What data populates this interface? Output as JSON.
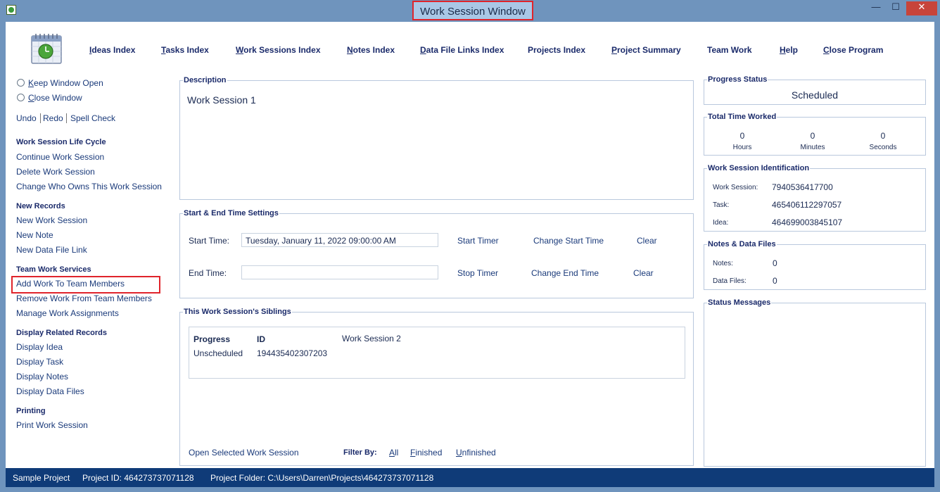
{
  "window": {
    "title": "Work Session Window",
    "min_glyph": "—",
    "max_glyph": "☐",
    "close_glyph": "✕"
  },
  "nav": {
    "items": [
      "Ideas Index",
      "Tasks Index",
      "Work Sessions Index",
      "Notes Index",
      "Data File Links Index",
      "Projects Index",
      "Project Summary",
      "Team Work",
      "Help",
      "Close Program"
    ]
  },
  "left": {
    "keep_open": "Keep Window Open",
    "close_window": "Close Window",
    "undo": "Undo",
    "redo": "Redo",
    "spell_check": "Spell Check",
    "lifecycle_head": "Work Session Life Cycle",
    "continue": "Continue Work Session",
    "delete": "Delete Work Session",
    "change_owner": "Change Who Owns This Work Session",
    "new_records_head": "New Records",
    "new_ws": "New Work Session",
    "new_note": "New Note",
    "new_dfl": "New Data File Link",
    "team_head": "Team Work Services",
    "add_work": "Add Work To Team Members",
    "remove_work": "Remove Work From Team Members",
    "manage": "Manage Work Assignments",
    "related_head": "Display Related Records",
    "disp_idea": "Display Idea",
    "disp_task": "Display Task",
    "disp_notes": "Display Notes",
    "disp_files": "Display Data Files",
    "printing_head": "Printing",
    "print_ws": "Print Work Session"
  },
  "description": {
    "label": "Description",
    "value": "Work Session 1"
  },
  "times": {
    "label": "Start & End Time Settings",
    "start_label": "Start Time:",
    "start_value": "Tuesday, January 11, 2022   09:00:00 AM",
    "start_timer": "Start Timer",
    "change_start": "Change Start Time",
    "clear1": "Clear",
    "end_label": "End Time:",
    "end_value": "",
    "stop_timer": "Stop Timer",
    "change_end": "Change End Time",
    "clear2": "Clear"
  },
  "siblings": {
    "label": "This Work Session's Siblings",
    "col_progress": "Progress",
    "col_id": "ID",
    "col_name": "Work Session 2",
    "row_progress": "Unscheduled",
    "row_id": "194435402307203",
    "open_selected": "Open Selected Work Session",
    "filter_by": "Filter By:",
    "all": "All",
    "finished": "Finished",
    "unfinished": "Unfinished"
  },
  "progress": {
    "label": "Progress Status",
    "value": "Scheduled"
  },
  "total_time": {
    "label": "Total Time Worked",
    "hours": "0",
    "minutes": "0",
    "seconds": "0",
    "hours_label": "Hours",
    "minutes_label": "Minutes",
    "seconds_label": "Seconds"
  },
  "identification": {
    "label": "Work Session Identification",
    "ws_label": "Work Session:",
    "ws_value": "7940536417700",
    "task_label": "Task:",
    "task_value": "465406112297057",
    "idea_label": "Idea:",
    "idea_value": "464699003845107"
  },
  "notes_files": {
    "label": "Notes & Data Files",
    "notes_label": "Notes:",
    "notes_value": "0",
    "files_label": "Data Files:",
    "files_value": "0"
  },
  "status_messages": {
    "label": "Status Messages"
  },
  "statusbar": {
    "project": "Sample Project",
    "project_id": "Project ID:  464273737071128",
    "project_folder": "Project Folder:  C:\\Users\\Darren\\Projects\\464273737071128"
  }
}
